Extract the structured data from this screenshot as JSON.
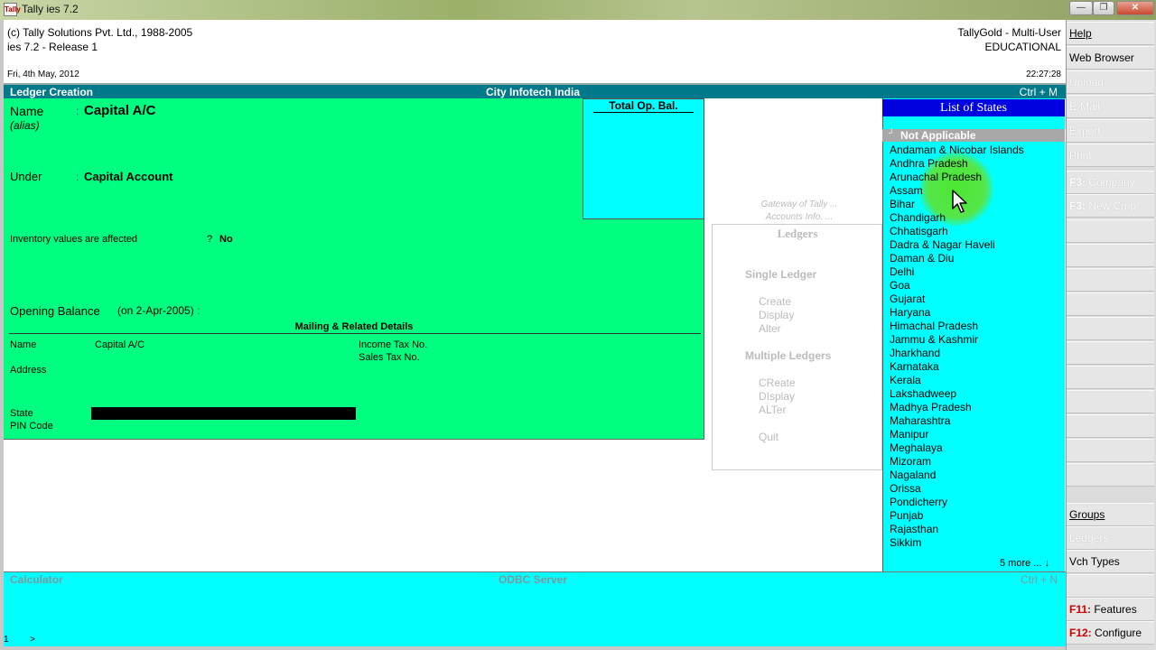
{
  "window": {
    "title": "Tally ies 7.2",
    "icon_text": "Tally",
    "min": "—",
    "max": "❐",
    "close": "✕"
  },
  "header": {
    "copyright": "(c) Tally Solutions Pvt. Ltd., 1988-2005",
    "release": "ies 7.2 - Release 1",
    "date": "Fri, 4th May, 2012",
    "product": "TallyGold - Multi-User",
    "edition": "EDUCATIONAL",
    "time": "22:27:28"
  },
  "screen": {
    "title": "Ledger Creation",
    "company": "City Infotech India",
    "shortcut": "Ctrl + M"
  },
  "form": {
    "name_label": "Name",
    "name_value": "Capital A/C",
    "alias_label": "(alias)",
    "under_label": "Under",
    "under_value": "Capital Account",
    "colon": ":",
    "inventory_label": "Inventory values are affected",
    "inventory_q": "?",
    "inventory_value": "No",
    "opening_label": "Opening Balance",
    "opening_date": "(on 2-Apr-2005)",
    "opening_colon": ":",
    "mailing_title": "Mailing & Related Details",
    "mail_name_label": "Name",
    "mail_name_value": "Capital A/C",
    "income_tax_label": "Income Tax No.",
    "sales_tax_label": "Sales Tax No.",
    "address_label": "Address",
    "state_label": "State",
    "pin_label": "PIN Code"
  },
  "opbal": {
    "title": "Total Op. Bal."
  },
  "gateway": {
    "caption1": "Gateway of Tally ...",
    "caption2": "Accounts Info. ...",
    "title": "Ledgers",
    "single_head": "Single Ledger",
    "single_items": [
      "Create",
      "Display",
      "Alter"
    ],
    "multiple_head": "Multiple Ledgers",
    "multiple_items": [
      "CReate",
      "DIsplay",
      "ALTer"
    ],
    "quit": "Quit"
  },
  "states": {
    "title": "List of States",
    "selected_mark": "┘",
    "selected": "Not Applicable",
    "items": [
      "Andaman & Nicobar Islands",
      "Andhra Pradesh",
      "Arunachal Pradesh",
      "Assam",
      "Bihar",
      "Chandigarh",
      "Chhatisgarh",
      "Dadra & Nagar Haveli",
      "Daman & Diu",
      "Delhi",
      "Goa",
      "Gujarat",
      "Haryana",
      "Himachal Pradesh",
      "Jammu & Kashmir",
      "Jharkhand",
      "Karnataka",
      "Kerala",
      "Lakshadweep",
      "Madhya Pradesh",
      "Maharashtra",
      "Manipur",
      "Meghalaya",
      "Mizoram",
      "Nagaland",
      "Orissa",
      "Pondicherry",
      "Punjab",
      "Rajasthan",
      "Sikkim"
    ],
    "more": "5 more ... ↓"
  },
  "bottom": {
    "calculator": "Calculator",
    "odbc": "ODBC Server",
    "odbc_shortcut": "Ctrl + N",
    "prompt_one": "1",
    "prompt_caret": ">"
  },
  "buttons": {
    "help": "Help",
    "web_browser": "Web Browser",
    "upload": "Upload",
    "email": "E-Mail",
    "export": "Export",
    "print": "Print",
    "company_key": "F3:",
    "company": " Company",
    "newcmp_key": "F3:",
    "newcmp": " New Cmp",
    "groups": "Groups",
    "ledgers": "Ledgers",
    "vch_types": "Vch Types",
    "features_key": "F11:",
    "features": " Features",
    "configure_key": "F12:",
    "configure": " Configure"
  },
  "colors": {
    "form_bg": "#00ff80",
    "panel_bg": "#00ffff",
    "title_bar": "#007a8a",
    "list_title": "#0000e0"
  }
}
